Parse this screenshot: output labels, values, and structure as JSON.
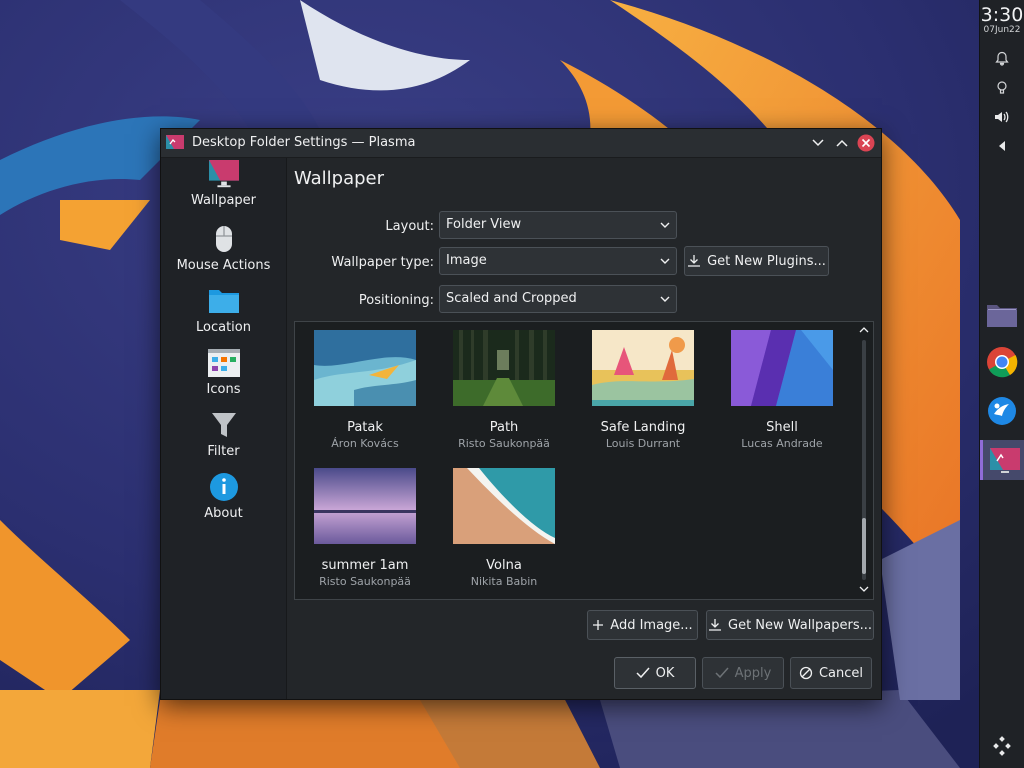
{
  "colors": {
    "accent": "#3daee9",
    "close_button": "#da4453",
    "panel_bg": "#1f2226",
    "dialog_bg": "#232629"
  },
  "panel": {
    "clock": "3:30",
    "date": "07Jun22",
    "tray_icons": [
      "bell-icon",
      "lightbulb-icon",
      "volume-icon",
      "collapse-arrow-icon"
    ],
    "tasks": [
      "folder-icon",
      "chrome-icon",
      "app-launcher-icon",
      "desktop-settings-icon"
    ]
  },
  "dialog": {
    "title": "Desktop Folder Settings — Plasma",
    "sidebar": [
      {
        "label": "Wallpaper",
        "icon": "monitor-icon"
      },
      {
        "label": "Mouse Actions",
        "icon": "mouse-icon"
      },
      {
        "label": "Location",
        "icon": "folder-icon"
      },
      {
        "label": "Icons",
        "icon": "icons-grid-icon"
      },
      {
        "label": "Filter",
        "icon": "funnel-icon"
      },
      {
        "label": "About",
        "icon": "info-icon"
      }
    ],
    "heading": "Wallpaper",
    "layout": {
      "label": "Layout:",
      "value": "Folder View"
    },
    "wallpaper_type": {
      "label": "Wallpaper type:",
      "value": "Image"
    },
    "positioning": {
      "label": "Positioning:",
      "value": "Scaled and Cropped"
    },
    "get_plugins": "Get New Plugins...",
    "wallpapers": [
      {
        "name": "Patak",
        "author": "Áron Kovács"
      },
      {
        "name": "Path",
        "author": "Risto Saukonpää"
      },
      {
        "name": "Safe Landing",
        "author": "Louis Durrant"
      },
      {
        "name": "Shell",
        "author": "Lucas Andrade"
      },
      {
        "name": "summer 1am",
        "author": "Risto Saukonpää"
      },
      {
        "name": "Volna",
        "author": "Nikita Babin"
      }
    ],
    "add_image": "Add Image...",
    "get_wallpapers": "Get New Wallpapers...",
    "ok": "OK",
    "apply": "Apply",
    "cancel": "Cancel"
  }
}
